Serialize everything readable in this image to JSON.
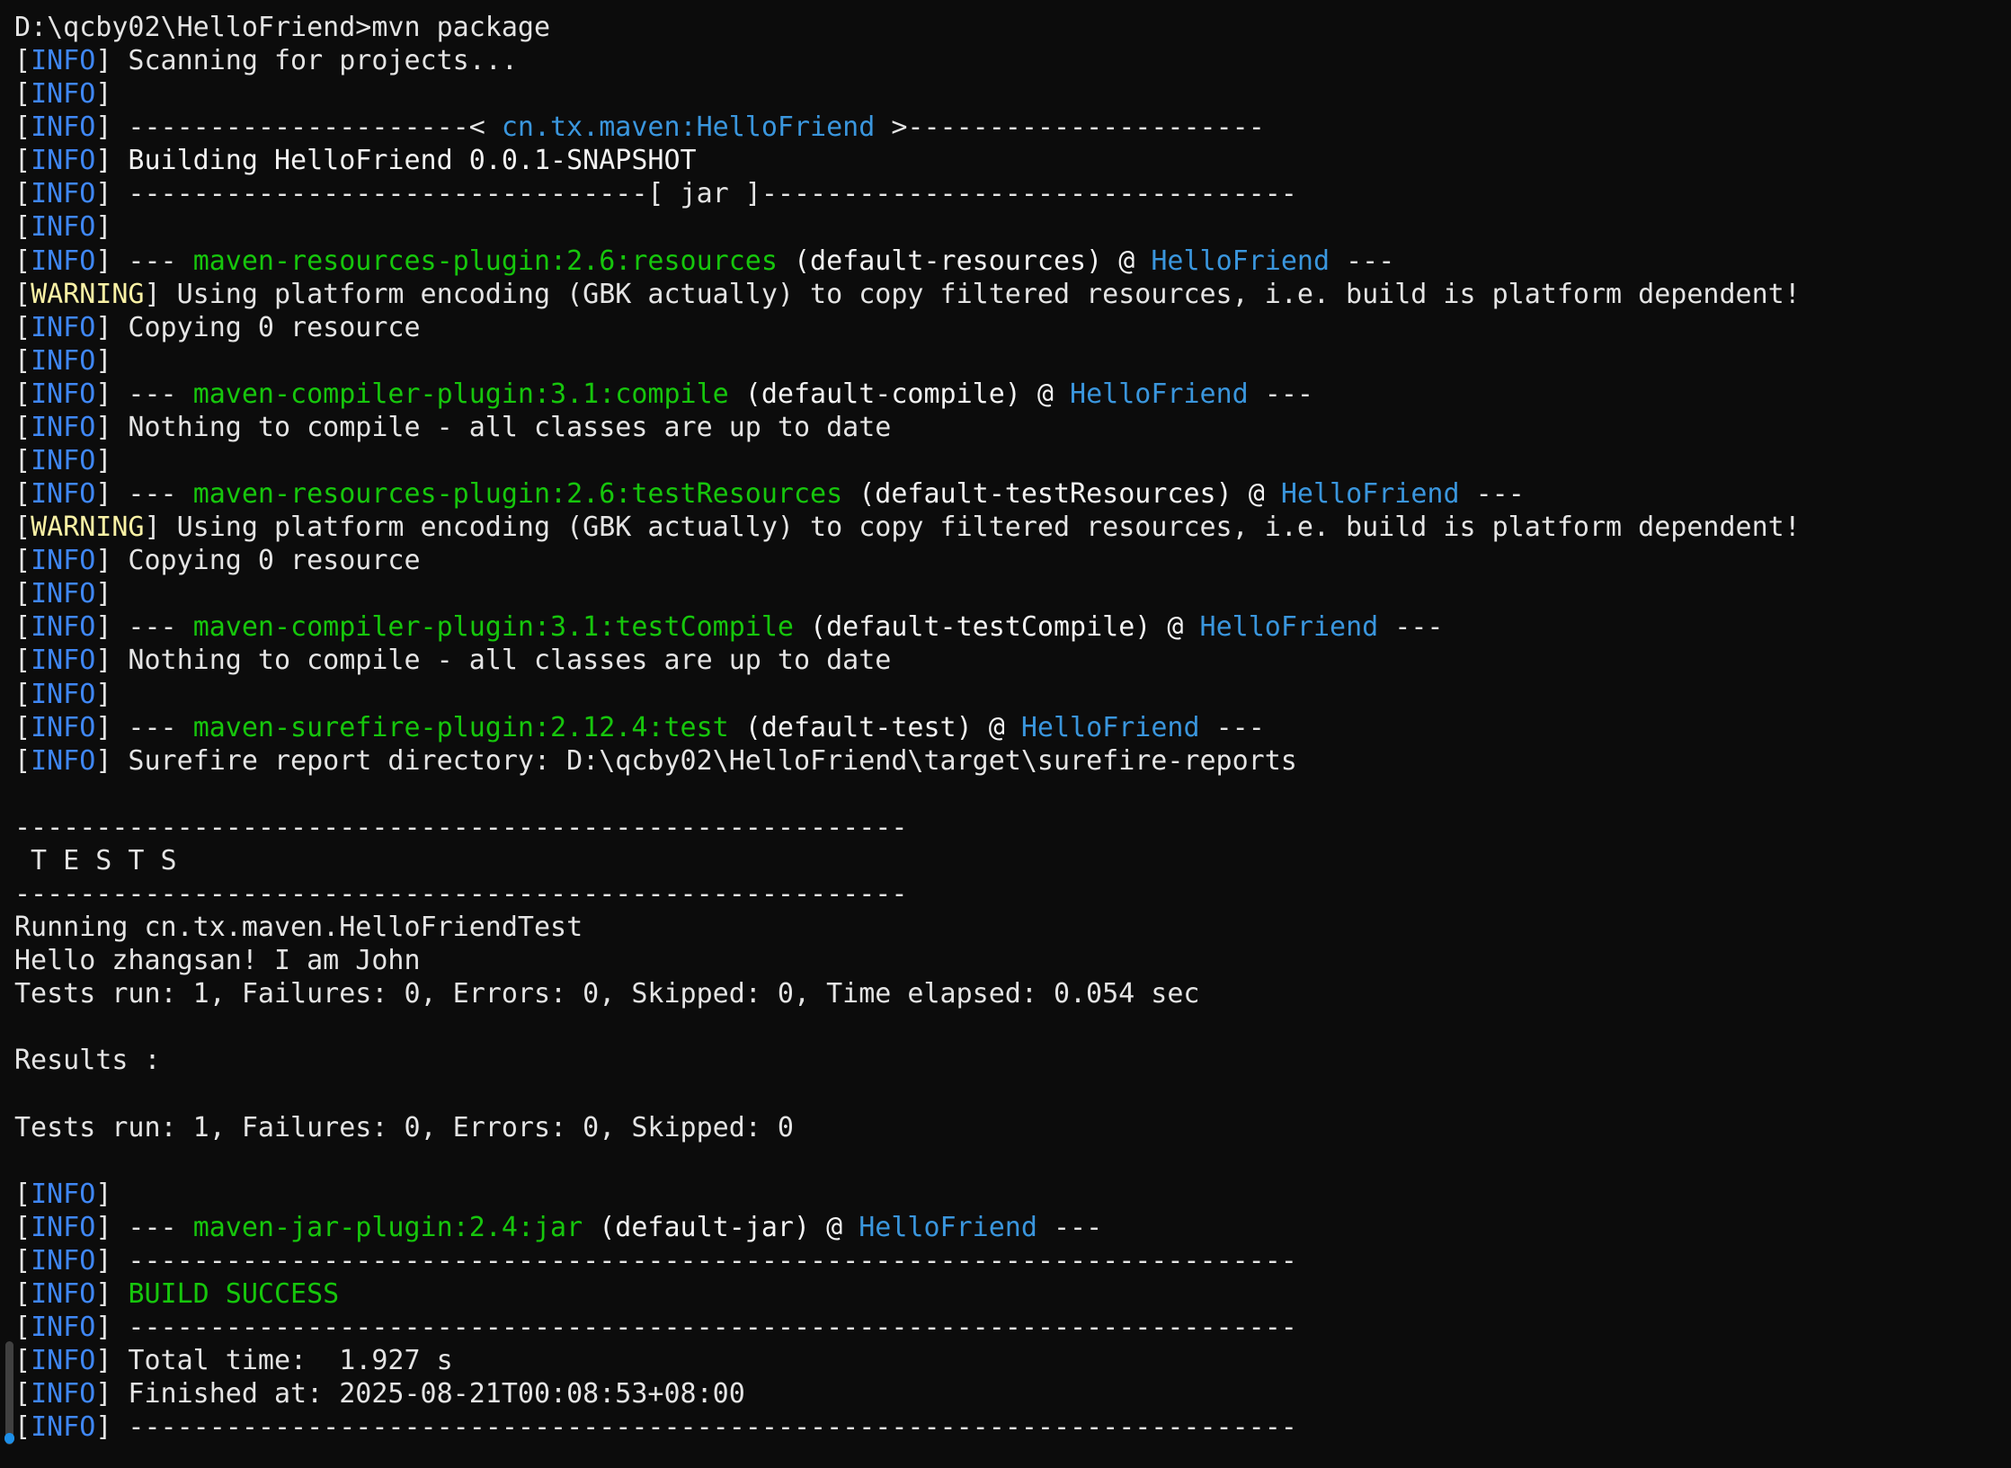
{
  "terminal": {
    "lines": [
      [
        {
          "t": "D:\\qcby02\\HelloFriend>mvn package",
          "c": "plain"
        }
      ],
      [
        {
          "t": "[",
          "c": "plain"
        },
        {
          "t": "INFO",
          "c": "info"
        },
        {
          "t": "] Scanning for projects...",
          "c": "plain"
        }
      ],
      [
        {
          "t": "[",
          "c": "plain"
        },
        {
          "t": "INFO",
          "c": "info"
        },
        {
          "t": "]",
          "c": "plain"
        }
      ],
      [
        {
          "t": "[",
          "c": "plain"
        },
        {
          "t": "INFO",
          "c": "info"
        },
        {
          "t": "] ---------------------< ",
          "c": "plain"
        },
        {
          "t": "cn.tx.maven:HelloFriend",
          "c": "project"
        },
        {
          "t": " >----------------------",
          "c": "plain"
        }
      ],
      [
        {
          "t": "[",
          "c": "plain"
        },
        {
          "t": "INFO",
          "c": "info"
        },
        {
          "t": "] Building HelloFriend 0.0.1-SNAPSHOT",
          "c": "bold"
        }
      ],
      [
        {
          "t": "[",
          "c": "plain"
        },
        {
          "t": "INFO",
          "c": "info"
        },
        {
          "t": "] --------------------------------[ jar ]---------------------------------",
          "c": "plain"
        }
      ],
      [
        {
          "t": "[",
          "c": "plain"
        },
        {
          "t": "INFO",
          "c": "info"
        },
        {
          "t": "]",
          "c": "plain"
        }
      ],
      [
        {
          "t": "[",
          "c": "plain"
        },
        {
          "t": "INFO",
          "c": "info"
        },
        {
          "t": "] --- ",
          "c": "plain"
        },
        {
          "t": "maven-resources-plugin:2.6:resources",
          "c": "plugin"
        },
        {
          "t": " (default-resources) @ ",
          "c": "bold"
        },
        {
          "t": "HelloFriend",
          "c": "project"
        },
        {
          "t": " ---",
          "c": "plain"
        }
      ],
      [
        {
          "t": "[",
          "c": "plain"
        },
        {
          "t": "WARNING",
          "c": "warning"
        },
        {
          "t": "] Using platform encoding (GBK actually) to copy filtered resources, i.e. build is platform dependent!",
          "c": "plain"
        }
      ],
      [
        {
          "t": "[",
          "c": "plain"
        },
        {
          "t": "INFO",
          "c": "info"
        },
        {
          "t": "] Copying 0 resource",
          "c": "plain"
        }
      ],
      [
        {
          "t": "[",
          "c": "plain"
        },
        {
          "t": "INFO",
          "c": "info"
        },
        {
          "t": "]",
          "c": "plain"
        }
      ],
      [
        {
          "t": "[",
          "c": "plain"
        },
        {
          "t": "INFO",
          "c": "info"
        },
        {
          "t": "] --- ",
          "c": "plain"
        },
        {
          "t": "maven-compiler-plugin:3.1:compile",
          "c": "plugin"
        },
        {
          "t": " (default-compile) @ ",
          "c": "bold"
        },
        {
          "t": "HelloFriend",
          "c": "project"
        },
        {
          "t": " ---",
          "c": "plain"
        }
      ],
      [
        {
          "t": "[",
          "c": "plain"
        },
        {
          "t": "INFO",
          "c": "info"
        },
        {
          "t": "] Nothing to compile - all classes are up to date",
          "c": "plain"
        }
      ],
      [
        {
          "t": "[",
          "c": "plain"
        },
        {
          "t": "INFO",
          "c": "info"
        },
        {
          "t": "]",
          "c": "plain"
        }
      ],
      [
        {
          "t": "[",
          "c": "plain"
        },
        {
          "t": "INFO",
          "c": "info"
        },
        {
          "t": "] --- ",
          "c": "plain"
        },
        {
          "t": "maven-resources-plugin:2.6:testResources",
          "c": "plugin"
        },
        {
          "t": " (default-testResources) @ ",
          "c": "bold"
        },
        {
          "t": "HelloFriend",
          "c": "project"
        },
        {
          "t": " ---",
          "c": "plain"
        }
      ],
      [
        {
          "t": "[",
          "c": "plain"
        },
        {
          "t": "WARNING",
          "c": "warning"
        },
        {
          "t": "] Using platform encoding (GBK actually) to copy filtered resources, i.e. build is platform dependent!",
          "c": "plain"
        }
      ],
      [
        {
          "t": "[",
          "c": "plain"
        },
        {
          "t": "INFO",
          "c": "info"
        },
        {
          "t": "] Copying 0 resource",
          "c": "plain"
        }
      ],
      [
        {
          "t": "[",
          "c": "plain"
        },
        {
          "t": "INFO",
          "c": "info"
        },
        {
          "t": "]",
          "c": "plain"
        }
      ],
      [
        {
          "t": "[",
          "c": "plain"
        },
        {
          "t": "INFO",
          "c": "info"
        },
        {
          "t": "] --- ",
          "c": "plain"
        },
        {
          "t": "maven-compiler-plugin:3.1:testCompile",
          "c": "plugin"
        },
        {
          "t": " (default-testCompile) @ ",
          "c": "bold"
        },
        {
          "t": "HelloFriend",
          "c": "project"
        },
        {
          "t": " ---",
          "c": "plain"
        }
      ],
      [
        {
          "t": "[",
          "c": "plain"
        },
        {
          "t": "INFO",
          "c": "info"
        },
        {
          "t": "] Nothing to compile - all classes are up to date",
          "c": "plain"
        }
      ],
      [
        {
          "t": "[",
          "c": "plain"
        },
        {
          "t": "INFO",
          "c": "info"
        },
        {
          "t": "]",
          "c": "plain"
        }
      ],
      [
        {
          "t": "[",
          "c": "plain"
        },
        {
          "t": "INFO",
          "c": "info"
        },
        {
          "t": "] --- ",
          "c": "plain"
        },
        {
          "t": "maven-surefire-plugin:2.12.4:test",
          "c": "plugin"
        },
        {
          "t": " (default-test) @ ",
          "c": "bold"
        },
        {
          "t": "HelloFriend",
          "c": "project"
        },
        {
          "t": " ---",
          "c": "plain"
        }
      ],
      [
        {
          "t": "[",
          "c": "plain"
        },
        {
          "t": "INFO",
          "c": "info"
        },
        {
          "t": "] Surefire report directory: D:\\qcby02\\HelloFriend\\target\\surefire-reports",
          "c": "plain"
        }
      ],
      [
        {
          "t": "",
          "c": "plain"
        }
      ],
      [
        {
          "t": "-------------------------------------------------------",
          "c": "plain"
        }
      ],
      [
        {
          "t": " T E S T S",
          "c": "plain"
        }
      ],
      [
        {
          "t": "-------------------------------------------------------",
          "c": "plain"
        }
      ],
      [
        {
          "t": "Running cn.tx.maven.HelloFriendTest",
          "c": "plain"
        }
      ],
      [
        {
          "t": "Hello zhangsan! I am John",
          "c": "plain"
        }
      ],
      [
        {
          "t": "Tests run: 1, Failures: 0, Errors: 0, Skipped: 0, Time elapsed: 0.054 sec",
          "c": "plain"
        }
      ],
      [
        {
          "t": "",
          "c": "plain"
        }
      ],
      [
        {
          "t": "Results :",
          "c": "plain"
        }
      ],
      [
        {
          "t": "",
          "c": "plain"
        }
      ],
      [
        {
          "t": "Tests run: 1, Failures: 0, Errors: 0, Skipped: 0",
          "c": "plain"
        }
      ],
      [
        {
          "t": "",
          "c": "plain"
        }
      ],
      [
        {
          "t": "[",
          "c": "plain"
        },
        {
          "t": "INFO",
          "c": "info"
        },
        {
          "t": "]",
          "c": "plain"
        }
      ],
      [
        {
          "t": "[",
          "c": "plain"
        },
        {
          "t": "INFO",
          "c": "info"
        },
        {
          "t": "] --- ",
          "c": "plain"
        },
        {
          "t": "maven-jar-plugin:2.4:jar",
          "c": "plugin"
        },
        {
          "t": " (default-jar) @ ",
          "c": "bold"
        },
        {
          "t": "HelloFriend",
          "c": "project"
        },
        {
          "t": " ---",
          "c": "plain"
        }
      ],
      [
        {
          "t": "[",
          "c": "plain"
        },
        {
          "t": "INFO",
          "c": "info"
        },
        {
          "t": "] ------------------------------------------------------------------------",
          "c": "plain"
        }
      ],
      [
        {
          "t": "[",
          "c": "plain"
        },
        {
          "t": "INFO",
          "c": "info"
        },
        {
          "t": "] ",
          "c": "plain"
        },
        {
          "t": "BUILD SUCCESS",
          "c": "success"
        }
      ],
      [
        {
          "t": "[",
          "c": "plain"
        },
        {
          "t": "INFO",
          "c": "info"
        },
        {
          "t": "] ------------------------------------------------------------------------",
          "c": "plain"
        }
      ],
      [
        {
          "t": "[",
          "c": "plain"
        },
        {
          "t": "INFO",
          "c": "info"
        },
        {
          "t": "] Total time:  1.927 s",
          "c": "plain"
        }
      ],
      [
        {
          "t": "[",
          "c": "plain"
        },
        {
          "t": "INFO",
          "c": "info"
        },
        {
          "t": "] Finished at: 2025-08-21T00:08:53+08:00",
          "c": "plain"
        }
      ],
      [
        {
          "t": "[",
          "c": "plain"
        },
        {
          "t": "INFO",
          "c": "info"
        },
        {
          "t": "] ------------------------------------------------------------------------",
          "c": "plain"
        }
      ]
    ]
  },
  "colors": {
    "background": "#0c0c0c",
    "text": "#e4e4e4",
    "info": "#3f87f5",
    "warning": "#f9f1a5",
    "plugin": "#16c60c",
    "project": "#3a96dd",
    "success": "#16c60c",
    "scrollbar_thumb": "#1d8fe8"
  },
  "scrollbar": {
    "position_fraction": 1.0
  }
}
